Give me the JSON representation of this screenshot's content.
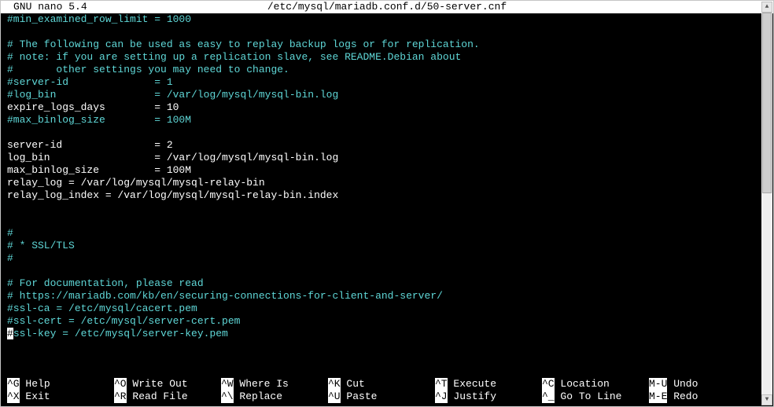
{
  "header": {
    "app": "GNU nano 5.4",
    "filepath": "/etc/mysql/mariadb.conf.d/50-server.cnf"
  },
  "editor": {
    "lines": [
      {
        "segments": [
          {
            "text": "#min_examined_row_limit = 1000",
            "style": "c"
          }
        ]
      },
      {
        "segments": [
          {
            "text": "",
            "style": "c"
          }
        ]
      },
      {
        "segments": [
          {
            "text": "# The following can be used as easy to replay backup logs or for replication.",
            "style": "c"
          }
        ]
      },
      {
        "segments": [
          {
            "text": "# note: if you are setting up a replication slave, see README.Debian about",
            "style": "c"
          }
        ]
      },
      {
        "segments": [
          {
            "text": "#       other settings you may need to change.",
            "style": "c"
          }
        ]
      },
      {
        "segments": [
          {
            "text": "#server-id              = 1",
            "style": "c"
          }
        ]
      },
      {
        "segments": [
          {
            "text": "#log_bin                = /var/log/mysql/mysql-bin.log",
            "style": "c"
          }
        ]
      },
      {
        "segments": [
          {
            "text": "expire_logs_days        = 10",
            "style": "w"
          }
        ]
      },
      {
        "segments": [
          {
            "text": "#max_binlog_size        = 100M",
            "style": "c"
          }
        ]
      },
      {
        "segments": [
          {
            "text": "",
            "style": "c"
          }
        ]
      },
      {
        "segments": [
          {
            "text": "server-id               = 2",
            "style": "w"
          }
        ]
      },
      {
        "segments": [
          {
            "text": "log_bin                 = /var/log/mysql/mysql-bin.log",
            "style": "w"
          }
        ]
      },
      {
        "segments": [
          {
            "text": "max_binlog_size         = 100M",
            "style": "w"
          }
        ]
      },
      {
        "segments": [
          {
            "text": "relay_log = /var/log/mysql/mysql-relay-bin",
            "style": "w"
          }
        ]
      },
      {
        "segments": [
          {
            "text": "relay_log_index = /var/log/mysql/mysql-relay-bin.index",
            "style": "w"
          }
        ]
      },
      {
        "segments": [
          {
            "text": "",
            "style": "c"
          }
        ]
      },
      {
        "segments": [
          {
            "text": "",
            "style": "c"
          }
        ]
      },
      {
        "segments": [
          {
            "text": "#",
            "style": "c"
          }
        ]
      },
      {
        "segments": [
          {
            "text": "# * SSL/TLS",
            "style": "c"
          }
        ]
      },
      {
        "segments": [
          {
            "text": "#",
            "style": "c"
          }
        ]
      },
      {
        "segments": [
          {
            "text": "",
            "style": "c"
          }
        ]
      },
      {
        "segments": [
          {
            "text": "# For documentation, please read",
            "style": "c"
          }
        ]
      },
      {
        "segments": [
          {
            "text": "# https://mariadb.com/kb/en/securing-connections-for-client-and-server/",
            "style": "c"
          }
        ]
      },
      {
        "segments": [
          {
            "text": "#ssl-ca = /etc/mysql/cacert.pem",
            "style": "c"
          }
        ]
      },
      {
        "segments": [
          {
            "text": "#ssl-cert = /etc/mysql/server-cert.pem",
            "style": "c"
          }
        ]
      },
      {
        "segments": [
          {
            "text": "#",
            "style": "cur"
          },
          {
            "text": "ssl-key = /etc/mysql/server-key.pem",
            "style": "c"
          }
        ]
      }
    ]
  },
  "shortcuts": {
    "row1": [
      {
        "key": "^G",
        "label": " Help"
      },
      {
        "key": "^O",
        "label": " Write Out"
      },
      {
        "key": "^W",
        "label": " Where Is"
      },
      {
        "key": "^K",
        "label": " Cut"
      },
      {
        "key": "^T",
        "label": " Execute"
      },
      {
        "key": "^C",
        "label": " Location"
      },
      {
        "key": "M-U",
        "label": " Undo"
      }
    ],
    "row2": [
      {
        "key": "^X",
        "label": " Exit"
      },
      {
        "key": "^R",
        "label": " Read File"
      },
      {
        "key": "^\\",
        "label": " Replace"
      },
      {
        "key": "^U",
        "label": " Paste"
      },
      {
        "key": "^J",
        "label": " Justify"
      },
      {
        "key": "^_",
        "label": " Go To Line"
      },
      {
        "key": "M-E",
        "label": " Redo"
      }
    ]
  }
}
